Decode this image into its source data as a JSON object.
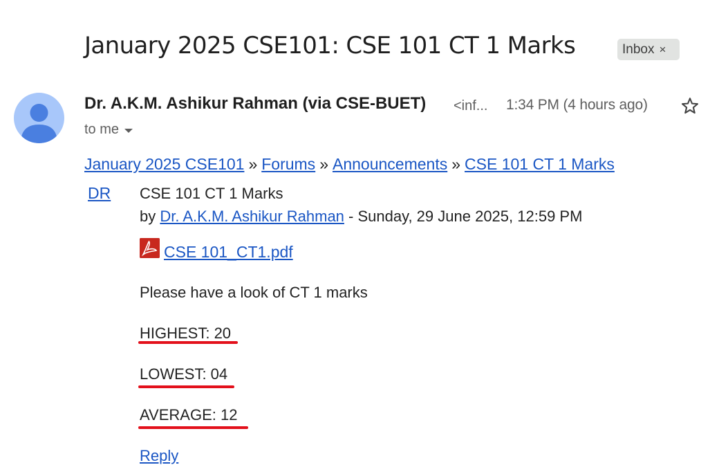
{
  "email": {
    "subject": "January 2025 CSE101: CSE 101 CT 1 Marks",
    "label": "Inbox",
    "label_close": "×",
    "sender_name": "Dr. A.K.M. Ashikur Rahman (via CSE-BUET)",
    "sender_email_truncated": "<inf...",
    "time": "1:34 PM (4 hours ago)",
    "recipient": "to me"
  },
  "breadcrumb": {
    "items": [
      "January 2025 CSE101",
      "Forums",
      "Announcements",
      "CSE 101 CT 1 Marks"
    ],
    "separator": "»"
  },
  "post": {
    "author_initials": "DR",
    "title": "CSE 101 CT 1 Marks",
    "by_prefix": "by",
    "author": "Dr. A.K.M. Ashikur Rahman",
    "date": " - Sunday, 29 June 2025, 12:59 PM",
    "attachment": "CSE 101_CT1.pdf",
    "message": "Please have a look of CT 1 marks",
    "stats": [
      "HIGHEST: 20",
      "LOWEST: 04",
      "AVERAGE: 12"
    ],
    "reply": "Reply"
  },
  "colors": {
    "link": "#1a56c4",
    "underline_annotation": "#e3101b",
    "avatar": "#a8c7fa"
  }
}
